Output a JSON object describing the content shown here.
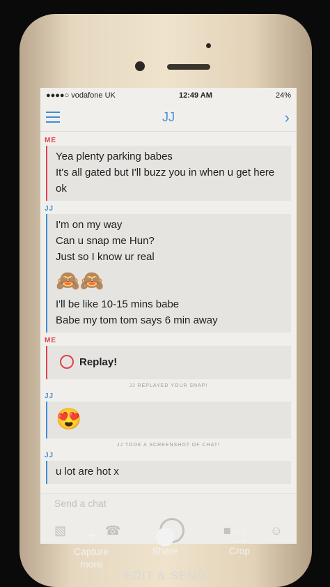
{
  "status_bar": {
    "carrier": "●●●●○ vodafone UK ",
    "time": "12:49 AM",
    "battery": "24%"
  },
  "header": {
    "title": "JJ",
    "menu_icon": "hamburger-icon",
    "next_icon": "chevron-right-icon"
  },
  "messages": {
    "m1_sender": "ME",
    "m1_lines": [
      "Yea plenty parking babes",
      "It's all gated but I'll buzz you in when u get here ok"
    ],
    "m2_sender": "JJ",
    "m2_lines": [
      "I'm on my way",
      "Can u snap me Hun?",
      "Just so I know ur real"
    ],
    "m2_emoji": "🙈🙈",
    "m2_lines_after": [
      "I'll be like 10-15 mins babe",
      "Babe my tom tom says 6 min away"
    ],
    "m3_sender": "ME",
    "m3_replay": "Replay!",
    "sys1": "JJ REPLAYED YOUR SNAP!",
    "m4_sender": "JJ",
    "m4_emoji": "😍",
    "sys2": "JJ TOOK A SCREENSHOT OF CHAT!",
    "m5_sender": "JJ",
    "m5_partial": "u lot are hot x"
  },
  "composer": {
    "placeholder": "Send a chat"
  },
  "actions": {
    "capture": "Capture\nmore",
    "share": "Share",
    "crop": "Crop",
    "edit_send": "EDIT & SEND"
  },
  "colors": {
    "accent_blue": "#3d8ed8",
    "accent_red": "#e0434b"
  }
}
